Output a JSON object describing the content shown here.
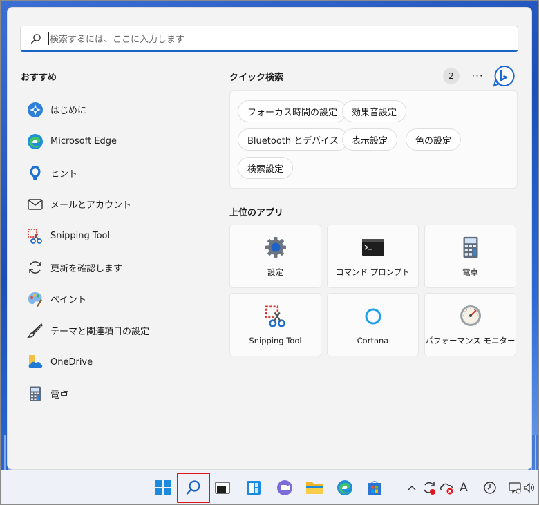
{
  "search": {
    "placeholder": "検索するには、ここに入力します"
  },
  "recommended": {
    "title": "おすすめ",
    "items": [
      {
        "label": "はじめに",
        "icon": "get-started-icon"
      },
      {
        "label": "Microsoft Edge",
        "icon": "edge-icon"
      },
      {
        "label": "ヒント",
        "icon": "tips-icon"
      },
      {
        "label": "メールとアカウント",
        "icon": "mail-icon"
      },
      {
        "label": "Snipping Tool",
        "icon": "snipping-tool-icon"
      },
      {
        "label": "更新を確認します",
        "icon": "refresh-icon"
      },
      {
        "label": "ペイント",
        "icon": "paint-icon"
      },
      {
        "label": "テーマと関連項目の設定",
        "icon": "brush-icon"
      },
      {
        "label": "OneDrive",
        "icon": "onedrive-icon"
      },
      {
        "label": "電卓",
        "icon": "calculator-icon"
      }
    ]
  },
  "quick_search": {
    "title": "クイック検索",
    "badge": "2",
    "more": "···",
    "chips": [
      "フォーカス時間の設定",
      "効果音設定",
      "Bluetooth とデバイス",
      "表示設定",
      "色の設定",
      "検索設定"
    ]
  },
  "top_apps": {
    "title": "上位のアプリ",
    "tiles": [
      {
        "label": "設定",
        "icon": "settings-gear-icon"
      },
      {
        "label": "コマンド プロンプト",
        "icon": "command-prompt-icon"
      },
      {
        "label": "電卓",
        "icon": "calculator-icon"
      },
      {
        "label": "Snipping Tool",
        "icon": "snipping-tool-icon"
      },
      {
        "label": "Cortana",
        "icon": "cortana-icon"
      },
      {
        "label": "パフォーマンス モニター",
        "icon": "performance-monitor-icon"
      }
    ]
  },
  "tray": {
    "ime": "A"
  },
  "colors": {
    "accent": "#1a62c4",
    "highlight": "#e0141c"
  }
}
